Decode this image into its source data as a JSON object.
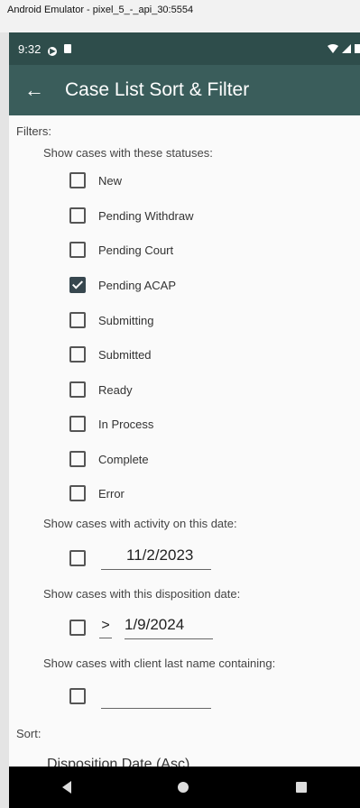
{
  "window": {
    "title": "Android Emulator - pixel_5_-_api_30:5554"
  },
  "status_bar": {
    "time": "9:32"
  },
  "app_bar": {
    "title": "Case List Sort & Filter"
  },
  "filters": {
    "heading": "Filters:",
    "statuses_label": "Show cases with these statuses:",
    "statuses": [
      {
        "label": "New",
        "checked": false
      },
      {
        "label": "Pending Withdraw",
        "checked": false
      },
      {
        "label": "Pending Court",
        "checked": false
      },
      {
        "label": "Pending ACAP",
        "checked": true
      },
      {
        "label": "Submitting",
        "checked": false
      },
      {
        "label": "Submitted",
        "checked": false
      },
      {
        "label": "Ready",
        "checked": false
      },
      {
        "label": "In Process",
        "checked": false
      },
      {
        "label": "Complete",
        "checked": false
      },
      {
        "label": "Error",
        "checked": false
      }
    ],
    "activity_label": "Show cases with activity on this date:",
    "activity_date": "11/2/2023",
    "disposition_label": "Show cases with this disposition date:",
    "disposition_operator": ">",
    "disposition_date": "1/9/2024",
    "lastname_label": "Show cases with client last name containing:",
    "lastname_value": ""
  },
  "sort": {
    "heading": "Sort:",
    "value": "Disposition Date (Asc)"
  }
}
